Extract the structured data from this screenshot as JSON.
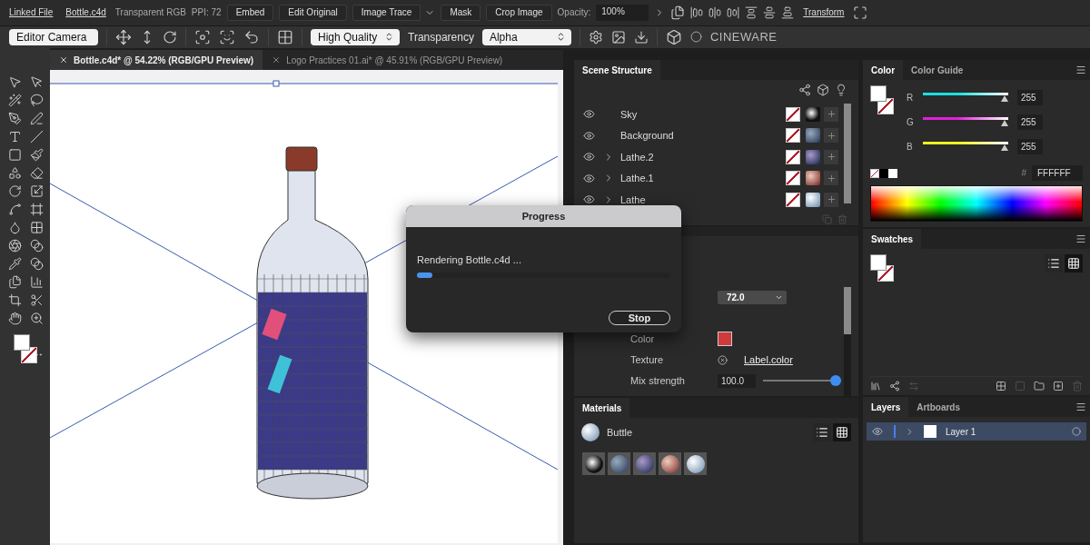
{
  "control_bar": {
    "items": [
      {
        "kind": "link",
        "label": "Linked File"
      },
      {
        "kind": "link",
        "label": "Bottle.c4d"
      },
      {
        "kind": "info",
        "label": "Transparent RGB"
      },
      {
        "kind": "info",
        "label": "PPI: 72"
      },
      {
        "kind": "button",
        "label": "Embed",
        "menu": false
      },
      {
        "kind": "button",
        "label": "Edit Original",
        "menu": false
      },
      {
        "kind": "button",
        "label": "Image Trace",
        "menu": true
      },
      {
        "kind": "button",
        "label": "Mask",
        "menu": false
      },
      {
        "kind": "button",
        "label": "Crop Image",
        "menu": false
      }
    ],
    "opacity": {
      "label": "Opacity:",
      "value": "100%"
    },
    "transform": "Transform"
  },
  "cineware_bar": {
    "camera": "Editor Camera",
    "quality": "High Quality",
    "transparency_label": "Transparency",
    "transparency": "Alpha",
    "brand": "CINEWARE"
  },
  "doc_tabs": [
    {
      "label": "Bottle.c4d* @ 54.22% (RGB/GPU Preview)",
      "selected": true
    },
    {
      "label": "Logo Practices 01.ai* @ 45.91% (RGB/GPU Preview)",
      "selected": false
    }
  ],
  "scene_structure": {
    "title": "Scene Structure",
    "objects": [
      {
        "name": "Sky",
        "expandable": false
      },
      {
        "name": "Background",
        "expandable": false
      },
      {
        "name": "Lathe.2",
        "expandable": true
      },
      {
        "name": "Lathe.1",
        "expandable": true
      },
      {
        "name": "Lathe",
        "expandable": true
      }
    ]
  },
  "properties": {
    "dropdown": "72.0",
    "color_label": "Color",
    "texture_label": "Texture",
    "texture": "Label.color",
    "mix_label": "Mix strength",
    "mix_value": "100.0",
    "mix": {
      "level": 1
    }
  },
  "materials": {
    "title": "Materials",
    "current": "Buttle",
    "views": [
      {
        "kind": "list",
        "selected": false
      },
      {
        "kind": "grid",
        "selected": true
      }
    ]
  },
  "progress": {
    "title": "Progress",
    "message": "Rendering Bottle.c4d ...",
    "level": 0.06,
    "button": "Stop"
  },
  "color_panel": {
    "tabs": [
      {
        "label": "Color",
        "selected": true
      },
      {
        "label": "Color Guide",
        "selected": false
      }
    ],
    "channels": [
      {
        "name": "R",
        "value": "255",
        "level": 1,
        "color": "#19e0e0"
      },
      {
        "name": "G",
        "value": "255",
        "level": 1,
        "color": "#e020d8"
      },
      {
        "name": "B",
        "value": "255",
        "level": 1,
        "color": "#f0f020"
      }
    ],
    "hex_mark": "#",
    "hex": "FFFFFF"
  },
  "swatches": {
    "title": "Swatches",
    "views": [
      {
        "kind": "list",
        "selected": false
      },
      {
        "kind": "grid",
        "selected": true
      }
    ]
  },
  "layers": {
    "tabs": [
      {
        "label": "Layers",
        "selected": true
      },
      {
        "label": "Artboards",
        "selected": false
      }
    ],
    "items": [
      {
        "name": "Layer 1",
        "selected": true,
        "visible": true
      }
    ]
  }
}
